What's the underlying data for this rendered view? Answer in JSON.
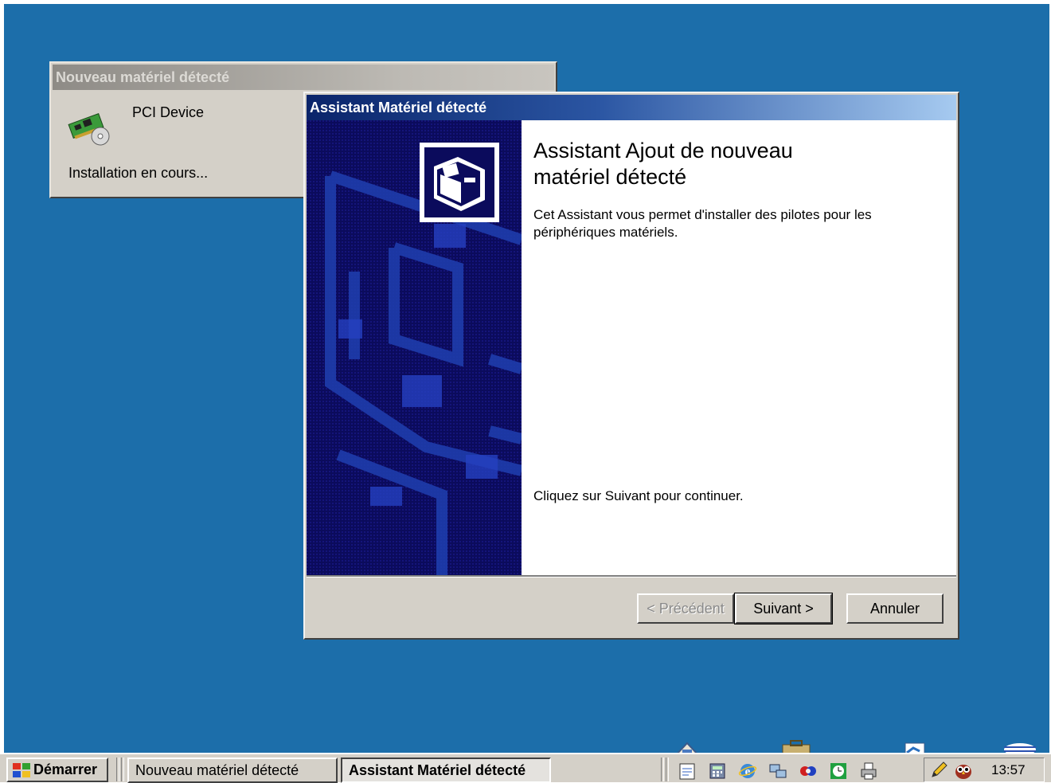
{
  "colors": {
    "desktop": "#1c6eaa",
    "active_title_start": "#0a246a",
    "active_title_end": "#a6caf0",
    "inactive_title": "#8e8b86",
    "window_face": "#d4d0c8",
    "wizard_banner": "#0b0b5c"
  },
  "found_window": {
    "title": "Nouveau matériel détecté",
    "icon": "pci-card-icon",
    "device_name": "PCI Device",
    "status": "Installation en cours..."
  },
  "wizard": {
    "title": "Assistant Matériel détecté",
    "banner_icon": "hardware-box-icon",
    "heading": "Assistant Ajout de nouveau matériel détecté",
    "description": "Cet Assistant vous permet d'installer des pilotes pour les périphériques matériels.",
    "continue_text": "Cliquez sur Suivant pour continuer.",
    "buttons": {
      "back": "< Précédent",
      "next": "Suivant >",
      "cancel": "Annuler"
    }
  },
  "taskbar": {
    "start_label": "Démarrer",
    "tasks": [
      {
        "label": "Nouveau matériel détecté",
        "active": false
      },
      {
        "label": "Assistant Matériel détecté",
        "active": true
      }
    ],
    "quick_launch": [
      "notepad-icon",
      "calculator-icon",
      "internet-explorer-icon",
      "network-icon",
      "media-icon",
      "clock-icon",
      "printer-icon"
    ],
    "tray_icons": [
      "pencil-icon",
      "owl-icon"
    ],
    "clock": "13:57"
  }
}
